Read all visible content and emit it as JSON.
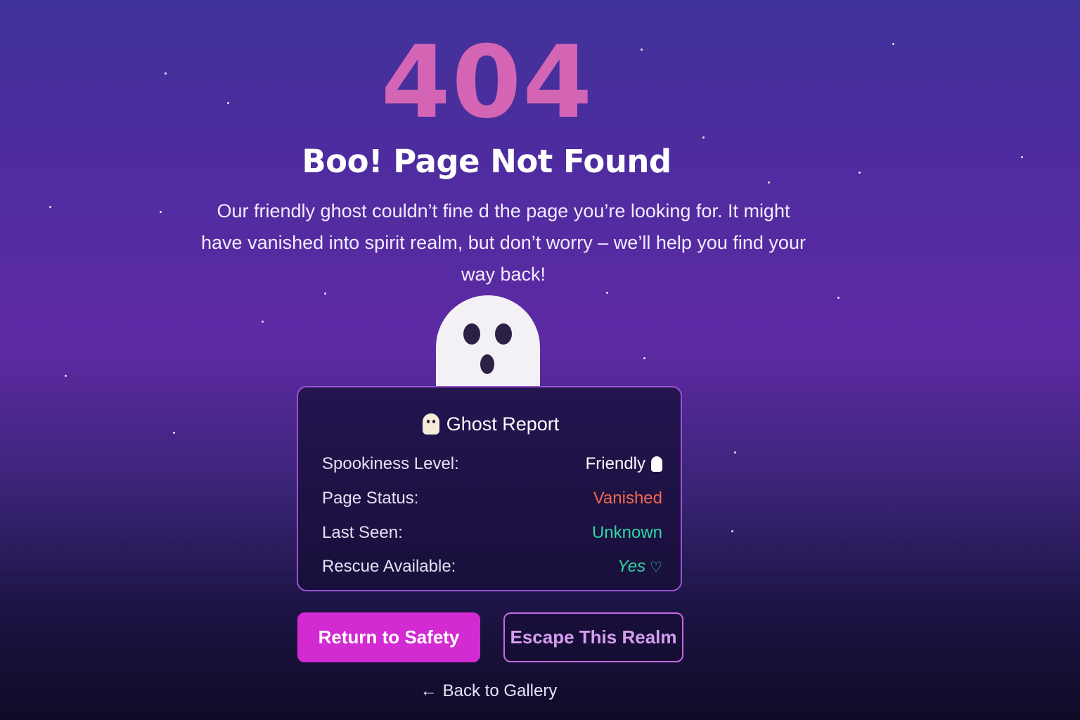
{
  "error": {
    "code": "404",
    "title": "Boo! Page Not Found",
    "description": "Our friendly ghost couldn’t fine d the page you’re looking for. It might have vanished into spirit realm, but don’t worry – we’ll help you find your way back!"
  },
  "report": {
    "title": "Ghost Report",
    "rows": [
      {
        "label": "Spookiness Level:",
        "value": "Friendly"
      },
      {
        "label": "Page Status:",
        "value": "Vanished"
      },
      {
        "label": "Last Seen:",
        "value": "Unknown"
      },
      {
        "label": "Rescue Available:",
        "value": "Yes"
      }
    ]
  },
  "actions": {
    "primary_label": "Return to Safety",
    "secondary_label": "Escape This Realm",
    "back_label": "Back to Gallery"
  },
  "icons": {
    "back_arrow": "←",
    "heart": "♡"
  },
  "colors": {
    "code": "#d465b4",
    "primary_button": "#d22bd1",
    "secondary_button_border": "#c66be0",
    "status_vanished": "#f06a4a",
    "status_ok": "#2fd6a2"
  }
}
